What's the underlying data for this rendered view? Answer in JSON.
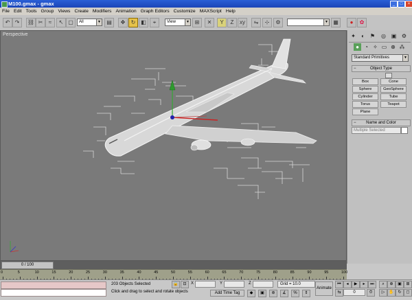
{
  "window": {
    "title": "M100.gmax - gmax",
    "minimize_glyph": "_",
    "maximize_glyph": "□",
    "close_glyph": "×"
  },
  "menu": [
    "File",
    "Edit",
    "Tools",
    "Group",
    "Views",
    "Create",
    "Modifiers",
    "Animation",
    "Graph Editors",
    "Customize",
    "MAXScript",
    "Help"
  ],
  "toolbar": {
    "selection_filter": "All",
    "ref_coord": "View",
    "named_selection": ""
  },
  "viewport": {
    "label": "Perspective"
  },
  "panel": {
    "category": "Standard Primitives",
    "object_type_header": "Object Type",
    "autogrid_label": "",
    "object_types": [
      "Box",
      "Cone",
      "Sphere",
      "GeoSphere",
      "Cylinder",
      "Tube",
      "Torus",
      "Teapot",
      "Plane"
    ],
    "name_color_header": "Name and Color",
    "name_field": "Multiple Selected",
    "swatch_color": "#ffffff"
  },
  "timeline": {
    "slider_text": "0 / 100",
    "ticks": [
      "0",
      "5",
      "10",
      "15",
      "20",
      "25",
      "30",
      "35",
      "40",
      "45",
      "50",
      "55",
      "60",
      "65",
      "70",
      "75",
      "80",
      "85",
      "90",
      "95",
      "100"
    ]
  },
  "status": {
    "selection_count": "203 Objects Selected",
    "prompt": "Click and drag to select and rotate objects",
    "x_label": "X",
    "y_label": "Y",
    "z_label": "Z",
    "x_value": "",
    "y_value": "",
    "z_value": "",
    "grid": "Grid = 10.0",
    "add_time_tag": "Add Time Tag",
    "animate": "Animate",
    "frame_value": "0"
  },
  "colors": {
    "viewport_bg": "#7a7a7a",
    "title_bar": "#1b45b8",
    "active_tool": "#e6c24a",
    "timeline_bg": "#9fa08a"
  }
}
